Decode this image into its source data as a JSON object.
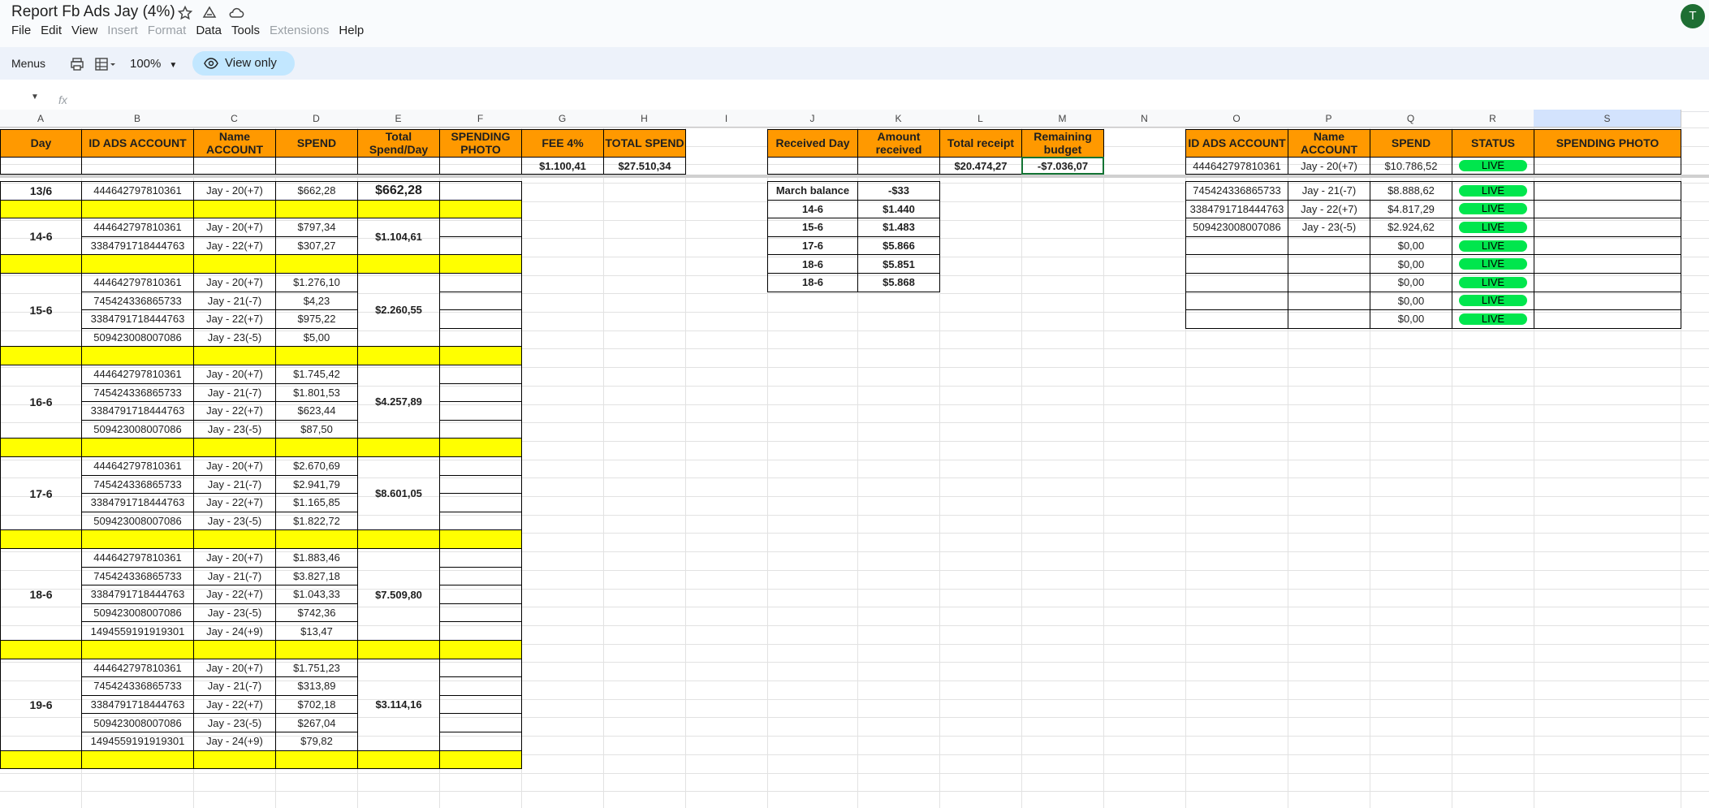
{
  "doc": {
    "title": "Report Fb Ads Jay (4%)",
    "avatar_letter": "T",
    "menus": [
      "File",
      "Edit",
      "View",
      "Insert",
      "Format",
      "Data",
      "Tools",
      "Extensions",
      "Help"
    ],
    "menus_disabled": [
      "Insert",
      "Format",
      "Extensions"
    ]
  },
  "toolbar": {
    "menus_label": "Menus",
    "zoom": "100%",
    "view_only": "View only"
  },
  "formula": {
    "fx": "fx"
  },
  "columns": [
    "A",
    "B",
    "C",
    "D",
    "E",
    "F",
    "G",
    "H",
    "I",
    "J",
    "K",
    "L",
    "M",
    "N",
    "O",
    "P",
    "Q",
    "R",
    "S"
  ],
  "headers": {
    "A": "Day",
    "B": "ID ADS ACCOUNT",
    "C": "Name ACCOUNT",
    "D": "SPEND",
    "E": "Total Spend/Day",
    "F": "SPENDING PHOTO",
    "G": "FEE 4%",
    "H": "TOTAL SPEND",
    "J": "Received Day",
    "K": "Amount received",
    "L": "Total receipt",
    "M": "Remaining budget",
    "O": "ID ADS ACCOUNT",
    "P": "Name ACCOUNT",
    "Q": "SPEND",
    "R": "STATUS",
    "S": "SPENDING PHOTO"
  },
  "totals": {
    "fee": "$1.100,41",
    "total_spend": "$27.510,34",
    "total_receipt": "$20.474,27",
    "remaining": "-$7.036,07"
  },
  "summary_row2": {
    "id": "444642797810361",
    "name": "Jay - 20(+7)",
    "spend": "$10.786,52",
    "status": "LIVE"
  },
  "days": [
    {
      "day": "13/6",
      "total": "$662,28",
      "rows": [
        {
          "id": "444642797810361",
          "name": "Jay - 20(+7)",
          "spend": "$662,28"
        }
      ]
    },
    {
      "day": "14-6",
      "total": "$1.104,61",
      "rows": [
        {
          "id": "444642797810361",
          "name": "Jay - 20(+7)",
          "spend": "$797,34"
        },
        {
          "id": "3384791718444763",
          "name": "Jay - 22(+7)",
          "spend": "$307,27"
        }
      ]
    },
    {
      "day": "15-6",
      "total": "$2.260,55",
      "rows": [
        {
          "id": "444642797810361",
          "name": "Jay - 20(+7)",
          "spend": "$1.276,10"
        },
        {
          "id": "745424336865733",
          "name": "Jay - 21(-7)",
          "spend": "$4,23"
        },
        {
          "id": "3384791718444763",
          "name": "Jay - 22(+7)",
          "spend": "$975,22"
        },
        {
          "id": "509423008007086",
          "name": "Jay - 23(-5)",
          "spend": "$5,00"
        }
      ]
    },
    {
      "day": "16-6",
      "total": "$4.257,89",
      "rows": [
        {
          "id": "444642797810361",
          "name": "Jay - 20(+7)",
          "spend": "$1.745,42"
        },
        {
          "id": "745424336865733",
          "name": "Jay - 21(-7)",
          "spend": "$1.801,53"
        },
        {
          "id": "3384791718444763",
          "name": "Jay - 22(+7)",
          "spend": "$623,44"
        },
        {
          "id": "509423008007086",
          "name": "Jay - 23(-5)",
          "spend": "$87,50"
        }
      ]
    },
    {
      "day": "17-6",
      "total": "$8.601,05",
      "rows": [
        {
          "id": "444642797810361",
          "name": "Jay - 20(+7)",
          "spend": "$2.670,69"
        },
        {
          "id": "745424336865733",
          "name": "Jay - 21(-7)",
          "spend": "$2.941,79"
        },
        {
          "id": "3384791718444763",
          "name": "Jay - 22(+7)",
          "spend": "$1.165,85"
        },
        {
          "id": "509423008007086",
          "name": "Jay - 23(-5)",
          "spend": "$1.822,72"
        }
      ]
    },
    {
      "day": "18-6",
      "total": "$7.509,80",
      "rows": [
        {
          "id": "444642797810361",
          "name": "Jay - 20(+7)",
          "spend": "$1.883,46"
        },
        {
          "id": "745424336865733",
          "name": "Jay - 21(-7)",
          "spend": "$3.827,18"
        },
        {
          "id": "3384791718444763",
          "name": "Jay - 22(+7)",
          "spend": "$1.043,33"
        },
        {
          "id": "509423008007086",
          "name": "Jay - 23(-5)",
          "spend": "$742,36"
        },
        {
          "id": "1494559191919301",
          "name": "Jay - 24(+9)",
          "spend": "$13,47"
        }
      ]
    },
    {
      "day": "19-6",
      "total": "$3.114,16",
      "rows": [
        {
          "id": "444642797810361",
          "name": "Jay - 20(+7)",
          "spend": "$1.751,23"
        },
        {
          "id": "745424336865733",
          "name": "Jay - 21(-7)",
          "spend": "$313,89"
        },
        {
          "id": "3384791718444763",
          "name": "Jay - 22(+7)",
          "spend": "$702,18"
        },
        {
          "id": "509423008007086",
          "name": "Jay - 23(-5)",
          "spend": "$267,04"
        },
        {
          "id": "1494559191919301",
          "name": "Jay - 24(+9)",
          "spend": "$79,82"
        }
      ]
    }
  ],
  "received": [
    {
      "day": "March balance",
      "amount": "-$33"
    },
    {
      "day": "14-6",
      "amount": "$1.440"
    },
    {
      "day": "15-6",
      "amount": "$1.483"
    },
    {
      "day": "17-6",
      "amount": "$5.866"
    },
    {
      "day": "18-6",
      "amount": "$5.851"
    },
    {
      "day": "18-6",
      "amount": "$5.868"
    }
  ],
  "accounts": [
    {
      "id": "745424336865733",
      "name": "Jay - 21(-7)",
      "spend": "$8.888,62",
      "status": "LIVE"
    },
    {
      "id": "3384791718444763",
      "name": "Jay - 22(+7)",
      "spend": "$4.817,29",
      "status": "LIVE"
    },
    {
      "id": "509423008007086",
      "name": "Jay - 23(-5)",
      "spend": "$2.924,62",
      "status": "LIVE"
    },
    {
      "id": "",
      "name": "",
      "spend": "$0,00",
      "status": "LIVE"
    },
    {
      "id": "",
      "name": "",
      "spend": "$0,00",
      "status": "LIVE"
    },
    {
      "id": "",
      "name": "",
      "spend": "$0,00",
      "status": "LIVE"
    },
    {
      "id": "",
      "name": "",
      "spend": "$0,00",
      "status": "LIVE"
    },
    {
      "id": "",
      "name": "",
      "spend": "$0,00",
      "status": "LIVE"
    }
  ],
  "colors": {
    "header": "#ff9900",
    "separator": "#ffff00",
    "live": "#00e64d",
    "selected_col": "#d3e3fd"
  }
}
